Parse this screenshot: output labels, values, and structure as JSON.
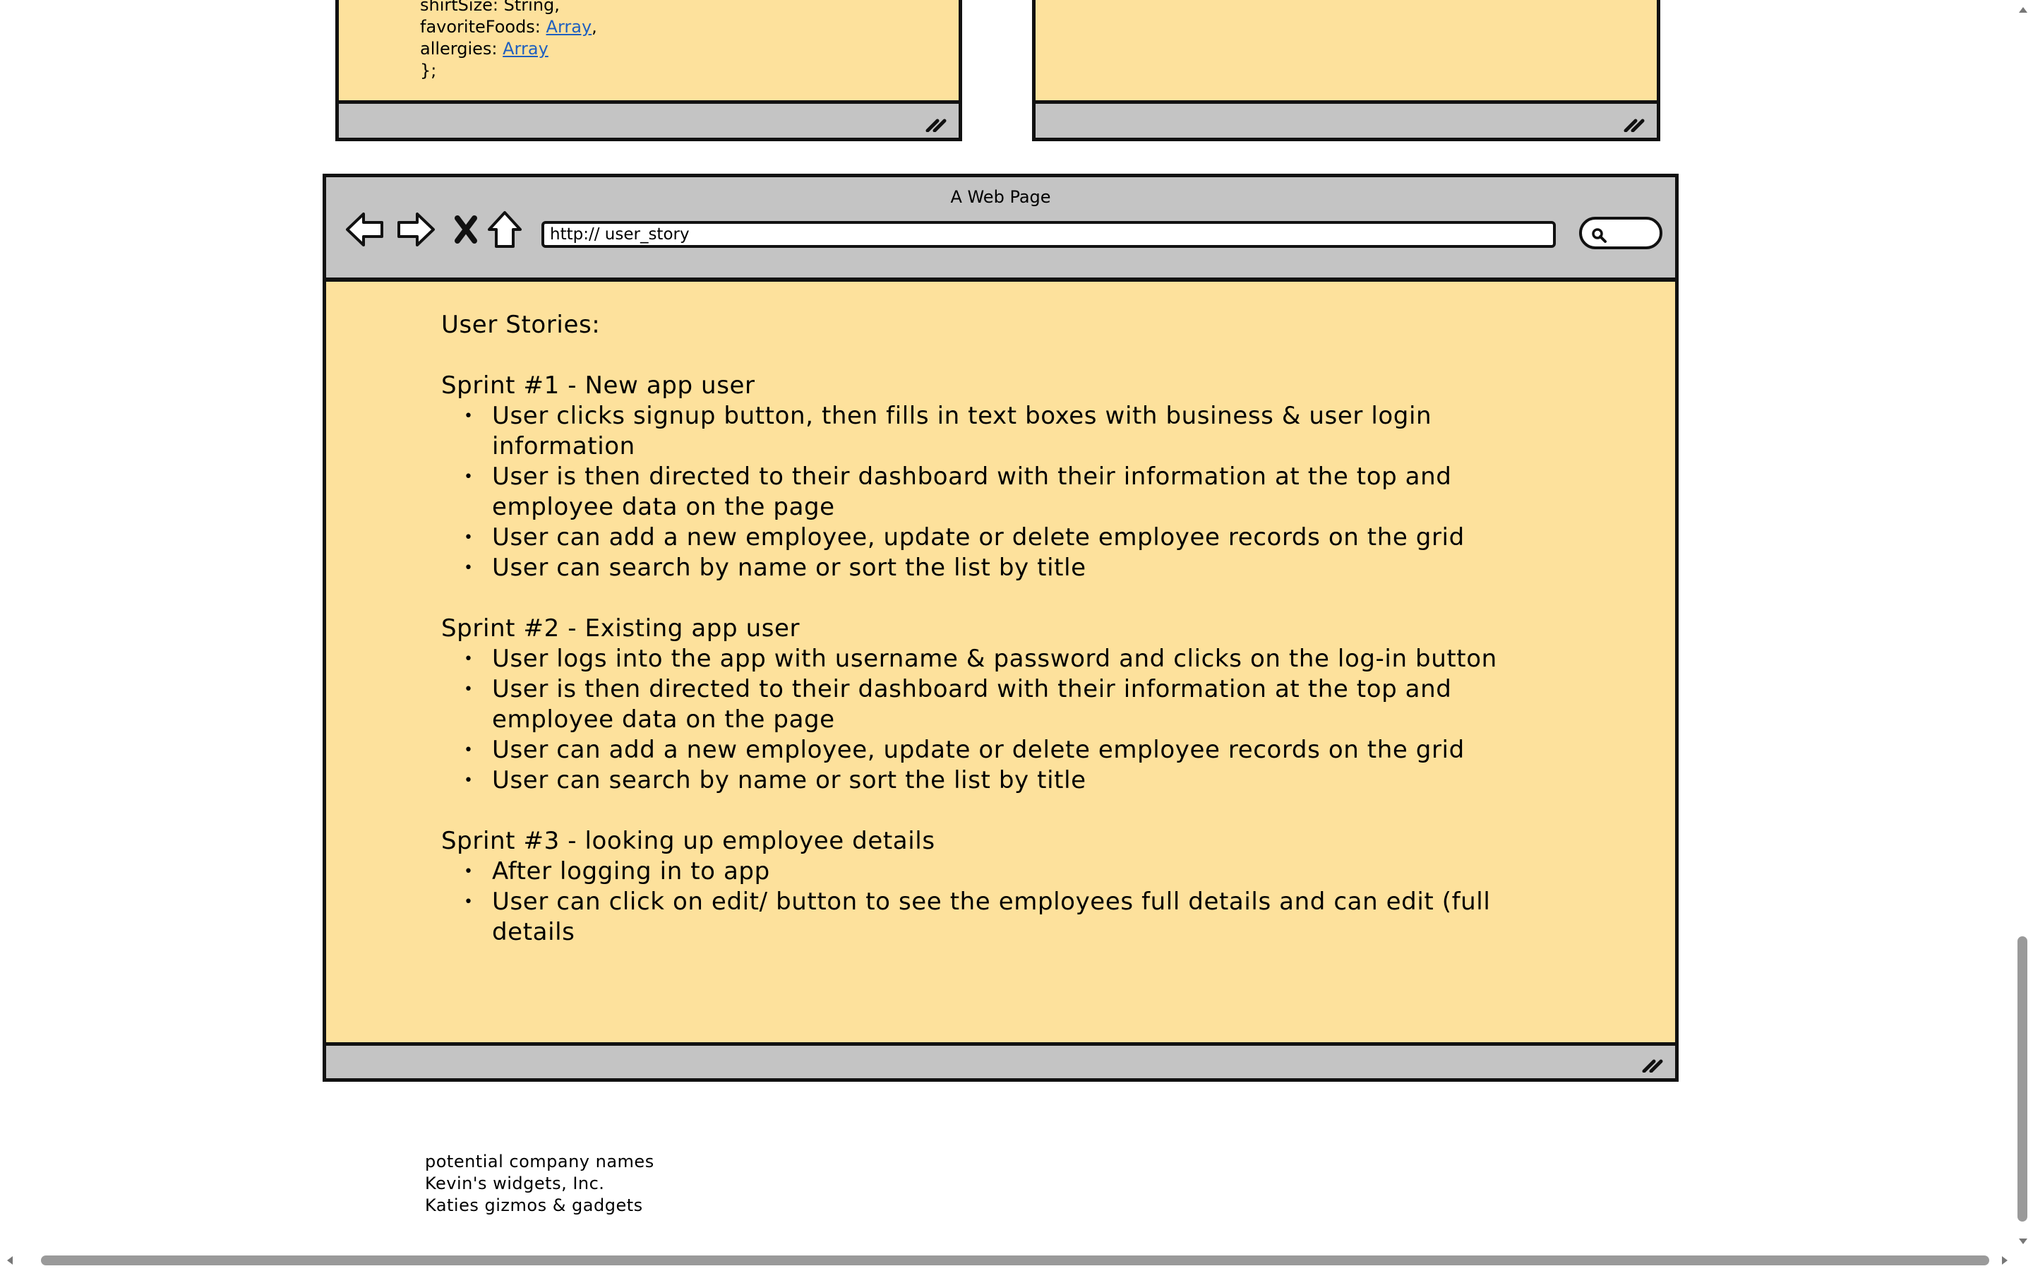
{
  "top_left_window": {
    "code_lines": [
      {
        "text": "shirtSize: String,",
        "link": "",
        "suffix": ""
      },
      {
        "text": "favoriteFoods: ",
        "link": "Array",
        "suffix": ","
      },
      {
        "text": "allergies: ",
        "link": "Array",
        "suffix": ""
      },
      {
        "text": "};",
        "link": "",
        "suffix": ""
      }
    ],
    "resize_icon": "resize-grip-icon"
  },
  "top_right_window": {
    "resize_icon": "resize-grip-icon"
  },
  "browser": {
    "title": "A Web Page",
    "address": "http:// user_story",
    "icons": [
      "back-arrow-icon",
      "forward-arrow-icon",
      "close-x-icon",
      "home-icon",
      "search-icon",
      "resize-grip-icon"
    ],
    "colors": {
      "content_bg": "#fde19c",
      "chrome_bg": "#c4c4c4",
      "outline": "#111111",
      "link": "#1f5fbf"
    }
  },
  "stories": {
    "title": "User Stories:",
    "sprints": [
      {
        "heading": "Sprint #1 - New app user",
        "items": [
          "User clicks signup button, then fills in text boxes with business & user login information",
          "User is then directed to their dashboard with their information at the top and employee data on the page",
          "User can add a new employee, update or delete employee records on the grid",
          "User can search by name or sort the list by title"
        ]
      },
      {
        "heading": "Sprint #2 - Existing app user",
        "items": [
          "User logs into the app with username & password and clicks on the log-in button",
          "User is then directed to their dashboard with their information at the top and employee data on the page",
          "User can add a new employee, update or delete employee records on the grid",
          "User can search by name or sort the list by title"
        ]
      },
      {
        "heading": "Sprint #3 - looking up employee details",
        "items": [
          "After logging in to app",
          "User can click on edit/ button to see the employees full details and can edit (full details"
        ]
      }
    ]
  },
  "notes": {
    "lines": [
      "potential company names",
      "Kevin's widgets, Inc.",
      "Katies gizmos & gadgets"
    ]
  }
}
